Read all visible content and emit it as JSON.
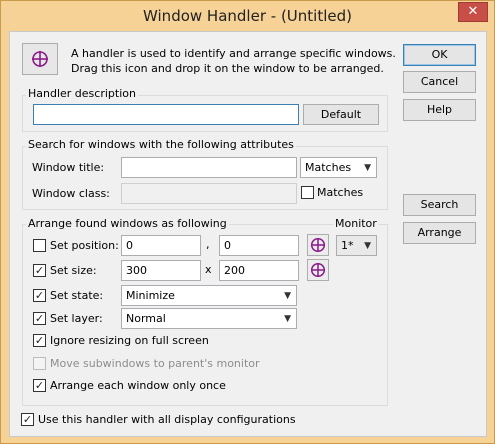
{
  "window": {
    "title": "Window Handler - (Untitled)",
    "close_glyph": "✕"
  },
  "intro": {
    "text_line1": "A handler is used to identify and arrange specific windows.",
    "text_line2": "Drag this icon and drop it on the window to be arranged.",
    "icon": "crosshair-icon"
  },
  "buttons": {
    "ok": "OK",
    "cancel": "Cancel",
    "help": "Help",
    "search": "Search",
    "arrange": "Arrange",
    "default": "Default"
  },
  "description": {
    "label": "Handler description",
    "value": ""
  },
  "search": {
    "label": "Search for windows with the following attributes",
    "window_title_label": "Window title:",
    "window_title_value": "",
    "match_mode": "Matches",
    "window_class_label": "Window class:",
    "window_class_value": "",
    "class_matches_label": "Matches"
  },
  "arrange": {
    "label": "Arrange found windows as following",
    "monitor_label": "Monitor",
    "monitor_value": "1*",
    "set_position_label": "Set position:",
    "pos_x": "0",
    "pos_sep": ",",
    "pos_y": "0",
    "set_size_label": "Set size:",
    "size_w": "300",
    "size_sep": "x",
    "size_h": "200",
    "set_state_label": "Set state:",
    "state_value": "Minimize",
    "set_layer_label": "Set layer:",
    "layer_value": "Normal",
    "ignore_label": "Ignore resizing on full screen",
    "move_sub_label": "Move subwindows to parent's monitor",
    "arrange_once_label": "Arrange each window only once"
  },
  "footer": {
    "all_displays_label": "Use this handler with all display configurations"
  },
  "checks": {
    "set_position": false,
    "set_size": true,
    "set_state": true,
    "set_layer": true,
    "ignore": true,
    "move_sub": false,
    "arrange_once": true,
    "all_displays": true,
    "class_matches": false
  },
  "colors": {
    "title_bar": "#f7d297",
    "close": "#c74f47",
    "client": "#f0f0f0",
    "crosshair": "#8a1a8a"
  }
}
